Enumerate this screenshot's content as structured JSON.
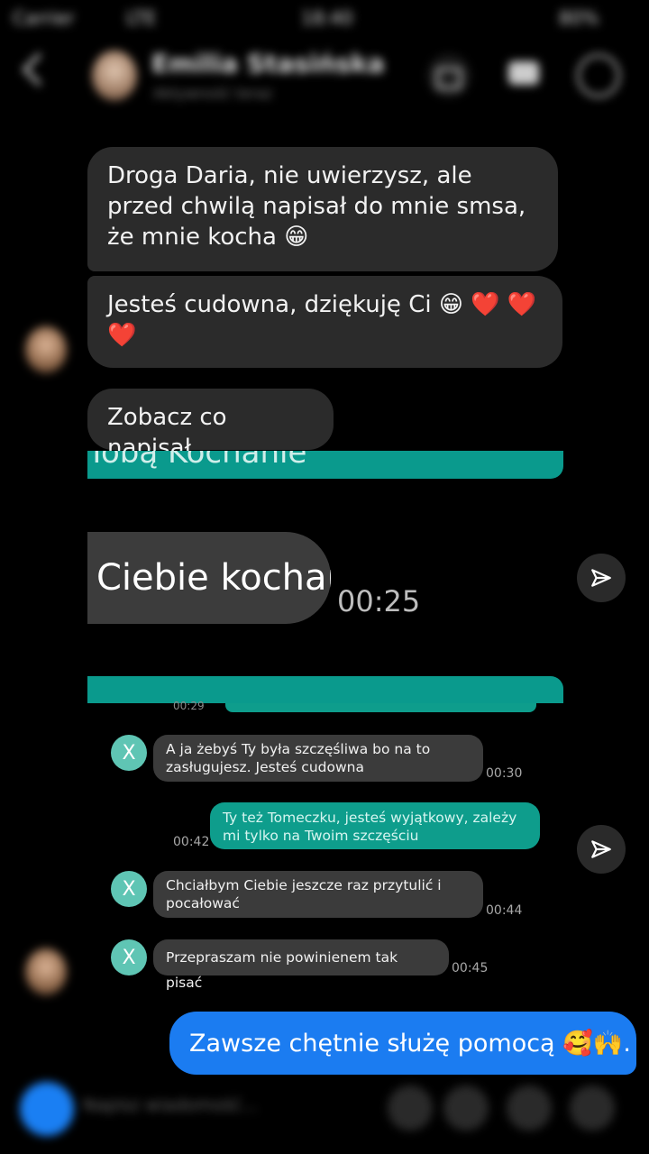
{
  "status_bar": {
    "carrier": "Carrier",
    "signal": "LTE",
    "time": "18:40",
    "battery": "80%"
  },
  "header": {
    "contact_name": "Emilia Stasińska",
    "subtitle": "Aktywność teraz"
  },
  "messages": [
    {
      "text": "Droga Daria, nie uwierzysz, ale przed chwilą napisał do mnie smsa, że mnie kocha 😁"
    },
    {
      "text": "Jesteś cudowna, dziękuję Ci 😁 ❤️ ❤️ ❤️"
    },
    {
      "text": "Zobacz co napisał"
    }
  ],
  "screenshot": {
    "top_strip_text": "Tobą Kochanie",
    "big_bubble_text": "Ciebie kocham",
    "big_bubble_time": "00:25",
    "strip_time_partial": "00:29",
    "sms": [
      {
        "sender_initial": "X",
        "text": "A ja żebyś Ty była szczęśliwa bo na to zasługujesz. Jesteś cudowna",
        "time": "00:30",
        "direction": "in"
      },
      {
        "text": "Ty też Tomeczku, jesteś wyjątkowy, zależy mi tylko na Twoim szczęściu",
        "time": "00:42",
        "direction": "out"
      },
      {
        "sender_initial": "X",
        "text": "Chciałbym Ciebie jeszcze raz przytulić i pocałować",
        "time": "00:44",
        "direction": "in"
      },
      {
        "sender_initial": "X",
        "text": "Przepraszam nie powinienem tak pisać",
        "time": "00:45",
        "direction": "in"
      }
    ]
  },
  "outgoing": {
    "text": "Zawsze chętnie służę pomocą 🥰🙌."
  },
  "composer": {
    "placeholder": "Napisz wiadomość..."
  },
  "icons": {
    "back": "chevron-left-icon",
    "video": "video-call-icon",
    "share": "send-arrow-icon"
  },
  "colors": {
    "background": "#000000",
    "incoming_bubble": "#2b2b2b",
    "outgoing_bubble": "#1b7cf1",
    "teal_accent": "#0a9a8d"
  }
}
